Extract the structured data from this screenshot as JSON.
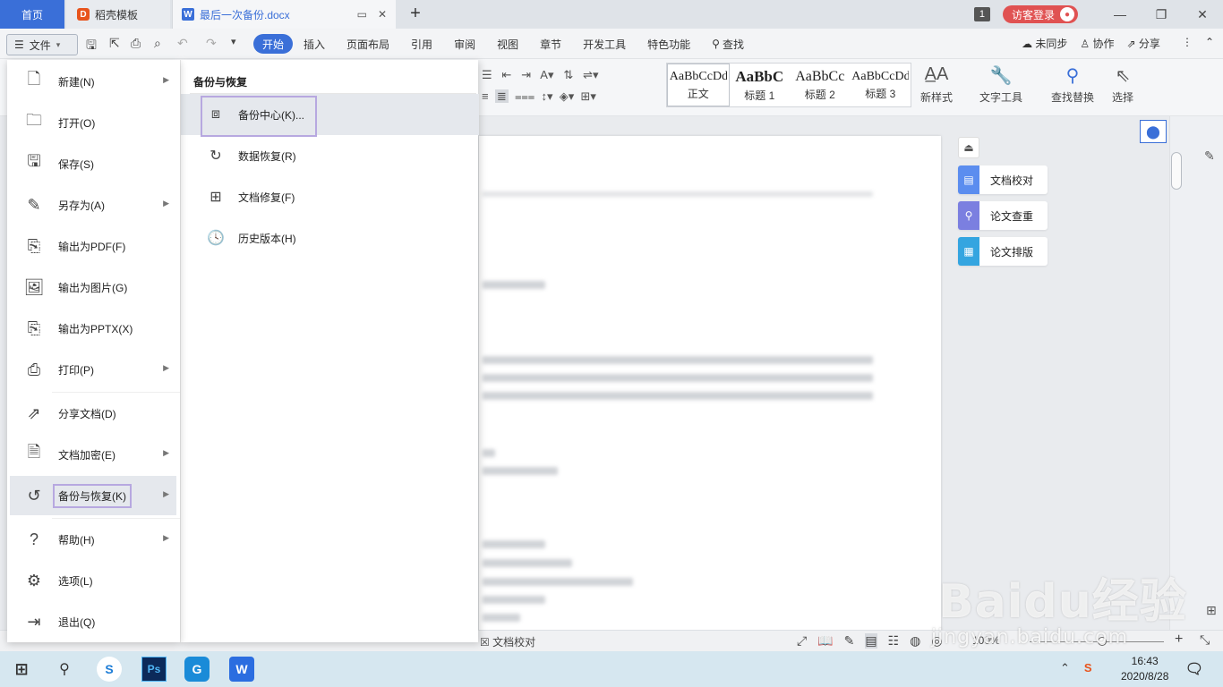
{
  "tabs": {
    "home": "首页",
    "template": "稻壳模板",
    "document": "最后一次备份.docx",
    "window_count": "1",
    "visitor_login": "访客登录"
  },
  "menubar": {
    "file_label": "文件",
    "items": [
      "开始",
      "插入",
      "页面布局",
      "引用",
      "审阅",
      "视图",
      "章节",
      "开发工具",
      "特色功能",
      "查找"
    ],
    "right": [
      "未同步",
      "协作",
      "分享"
    ]
  },
  "ribbon": {
    "styles": [
      {
        "sample": "AaBbCcDd",
        "name": "正文"
      },
      {
        "sample": "AaBbC",
        "name": "标题 1"
      },
      {
        "sample": "AaBbCc",
        "name": "标题 2"
      },
      {
        "sample": "AaBbCcDd",
        "name": "标题 3"
      }
    ],
    "new_style": "新样式",
    "text_tools": "文字工具",
    "find_replace": "查找替换",
    "select": "选择"
  },
  "file_menu": {
    "items": [
      {
        "label": "新建(N)",
        "icon": "new-doc-icon",
        "submenu": true
      },
      {
        "label": "打开(O)",
        "icon": "folder-icon",
        "submenu": false
      },
      {
        "label": "保存(S)",
        "icon": "save-icon",
        "submenu": false
      },
      {
        "label": "另存为(A)",
        "icon": "save-as-icon",
        "submenu": true
      },
      {
        "label": "输出为PDF(F)",
        "icon": "pdf-export-icon",
        "submenu": false
      },
      {
        "label": "输出为图片(G)",
        "icon": "image-export-icon",
        "submenu": false
      },
      {
        "label": "输出为PPTX(X)",
        "icon": "pptx-export-icon",
        "submenu": false
      },
      {
        "label": "打印(P)",
        "icon": "print-icon",
        "submenu": true
      },
      {
        "label": "分享文档(D)",
        "icon": "share-icon",
        "submenu": false
      },
      {
        "label": "文档加密(E)",
        "icon": "encrypt-icon",
        "submenu": true
      },
      {
        "label": "备份与恢复(K)",
        "icon": "backup-icon",
        "submenu": true
      },
      {
        "label": "帮助(H)",
        "icon": "help-icon",
        "submenu": true
      },
      {
        "label": "选项(L)",
        "icon": "settings-icon",
        "submenu": false
      },
      {
        "label": "退出(Q)",
        "icon": "exit-icon",
        "submenu": false
      }
    ]
  },
  "submenu": {
    "title": "备份与恢复",
    "items": [
      {
        "label": "备份中心(K)...",
        "icon": "backup-center-icon"
      },
      {
        "label": "数据恢复(R)",
        "icon": "data-recovery-icon"
      },
      {
        "label": "文档修复(F)",
        "icon": "doc-repair-icon"
      },
      {
        "label": "历史版本(H)",
        "icon": "history-icon"
      }
    ]
  },
  "side_panel": {
    "items": [
      {
        "label": "文档校对",
        "color": "#5b8def"
      },
      {
        "label": "论文查重",
        "color": "#7b7fe0"
      },
      {
        "label": "论文排版",
        "color": "#34a5e0"
      }
    ]
  },
  "statusbar": {
    "proofread": "文档校对",
    "zoom": "100%"
  },
  "taskbar": {
    "time": "16:43",
    "date": "2020/8/28"
  },
  "watermark": {
    "main": "Baidu经验",
    "sub": "jingyan.baidu.com"
  }
}
